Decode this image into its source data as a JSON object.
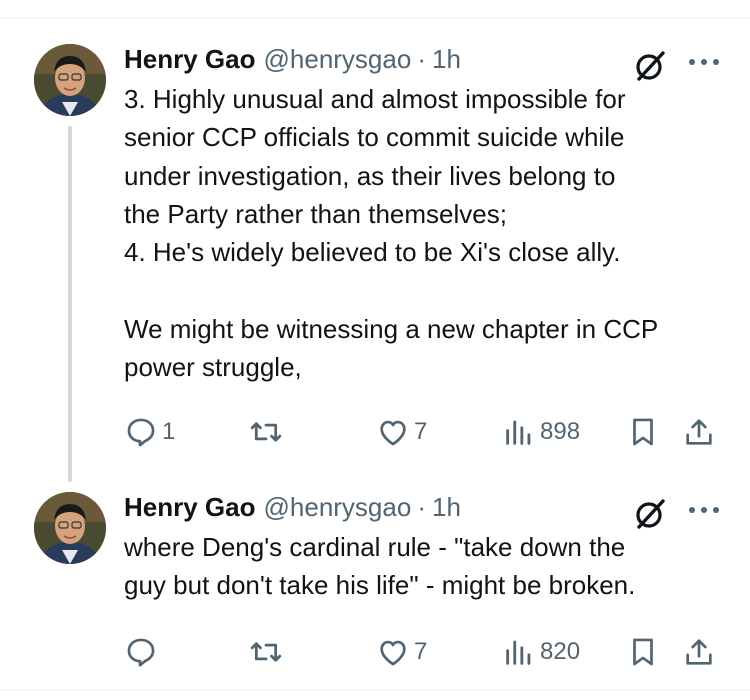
{
  "tweets": [
    {
      "author": "Henry Gao",
      "handle": "@henrysgao",
      "separator": "·",
      "time": "1h",
      "text": "3. Highly unusual and almost impossible for\nsenior CCP officials to commit suicide while\nunder investigation, as their lives belong to\nthe Party rather than themselves;\n4. He's widely believed to be Xi's close ally.\n\nWe might be witnessing a new chapter in CCP\npower struggle,",
      "replies": "1",
      "retweets": "",
      "likes": "7",
      "views": "898"
    },
    {
      "author": "Henry Gao",
      "handle": "@henrysgao",
      "separator": "·",
      "time": "1h",
      "text": "where Deng's cardinal rule - \"take down the\nguy but don't take his life\" - might be broken.",
      "replies": "",
      "retweets": "",
      "likes": "7",
      "views": "820"
    }
  ],
  "icons": {
    "reply": "reply-icon",
    "retweet": "retweet-icon",
    "like": "heart-icon",
    "views": "views-icon",
    "bookmark": "bookmark-icon",
    "share": "share-icon",
    "grok": "grok-icon",
    "more": "more-icon"
  },
  "colors": {
    "text": "#0f1419",
    "secondary": "#536471",
    "thread_line": "#cfd9de"
  }
}
